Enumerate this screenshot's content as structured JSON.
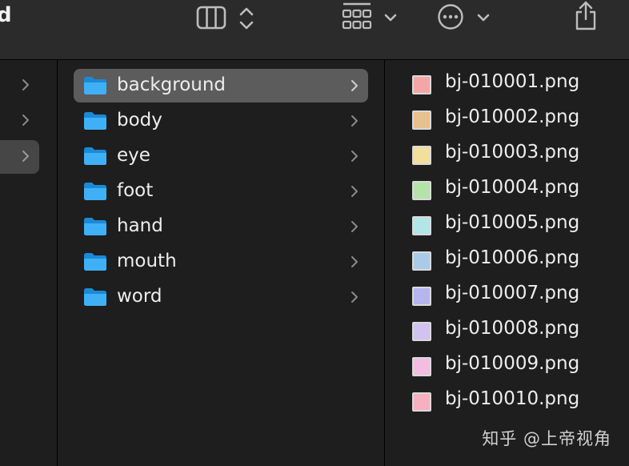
{
  "window": {
    "title_fragment": "d"
  },
  "toolbar": {
    "view_icon": "column-view-icon",
    "sort_icon": "up-down-chevron-icon",
    "group_icon": "grid-group-icon",
    "group_menu_icon": "chevron-down-icon",
    "action_icon": "more-ellipsis-icon",
    "action_menu_icon": "chevron-down-icon",
    "share_icon": "share-icon"
  },
  "sidebar_column": {
    "rows": [
      {
        "selected": false
      },
      {
        "selected": false
      },
      {
        "selected": true
      }
    ]
  },
  "folders": [
    {
      "label": "background",
      "selected": true
    },
    {
      "label": "body",
      "selected": false
    },
    {
      "label": "eye",
      "selected": false
    },
    {
      "label": "foot",
      "selected": false
    },
    {
      "label": "hand",
      "selected": false
    },
    {
      "label": "mouth",
      "selected": false
    },
    {
      "label": "word",
      "selected": false
    }
  ],
  "files": [
    {
      "label": "bj-010001.png",
      "color": "#f4a6a6"
    },
    {
      "label": "bj-010002.png",
      "color": "#e6c08e"
    },
    {
      "label": "bj-010003.png",
      "color": "#f1df9b"
    },
    {
      "label": "bj-010004.png",
      "color": "#b3e3a8"
    },
    {
      "label": "bj-010005.png",
      "color": "#b1e6e8"
    },
    {
      "label": "bj-010006.png",
      "color": "#a9cbe8"
    },
    {
      "label": "bj-010007.png",
      "color": "#b7b5ee"
    },
    {
      "label": "bj-010008.png",
      "color": "#d2c2ef"
    },
    {
      "label": "bj-010009.png",
      "color": "#f2bde0"
    },
    {
      "label": "bj-010010.png",
      "color": "#f7b0c0"
    }
  ],
  "watermark": "知乎 @上帝视角"
}
